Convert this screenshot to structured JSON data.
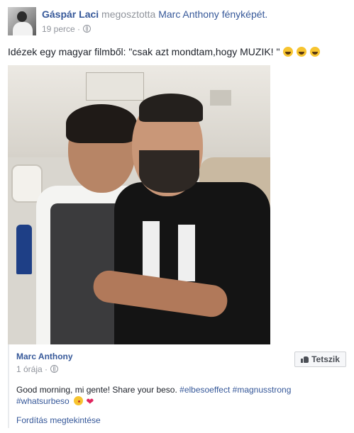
{
  "post": {
    "author": "Gáspár Laci",
    "action": "megosztotta",
    "shared_from": "Marc Anthony fényképét.",
    "time": "19 perce",
    "separator": "·",
    "text": "Idézek egy magyar filmből: \"csak azt mondtam,hogy MUZIK! \""
  },
  "shared": {
    "author": "Marc Anthony",
    "time": "1 órája",
    "separator": "·",
    "like_button": "Tetszik",
    "text": "Good morning, mi gente! Share your beso.",
    "hashtags": [
      "#elbesoeffect",
      "#magnusstrong",
      "#whatsurbeso"
    ],
    "translate_link": "Fordítás megtekintése"
  },
  "icons": {
    "privacy": "globe-icon",
    "laugh_emoji": "laughing-emoji-icon",
    "kiss_emoji": "kiss-emoji-icon",
    "heart": "heart-icon",
    "like": "thumbs-up-icon"
  },
  "colors": {
    "link": "#365899",
    "meta": "#90949c",
    "text": "#1d2129"
  }
}
